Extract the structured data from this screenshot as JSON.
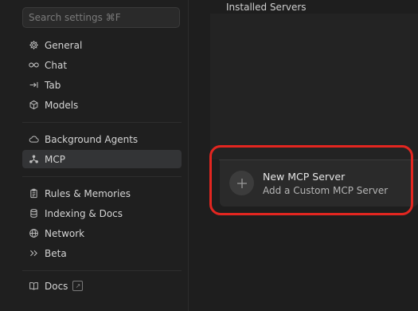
{
  "search": {
    "placeholder": "Search settings ⌘F"
  },
  "sidebar": {
    "items": [
      {
        "label": "General",
        "icon": "gear-icon"
      },
      {
        "label": "Chat",
        "icon": "infinity-icon"
      },
      {
        "label": "Tab",
        "icon": "arrow-to-line-icon"
      },
      {
        "label": "Models",
        "icon": "cube-icon"
      },
      {
        "label": "Background Agents",
        "icon": "cloud-icon"
      },
      {
        "label": "MCP",
        "icon": "nodes-icon",
        "active": true
      },
      {
        "label": "Rules & Memories",
        "icon": "clipboard-icon"
      },
      {
        "label": "Indexing & Docs",
        "icon": "database-icon"
      },
      {
        "label": "Network",
        "icon": "globe-icon"
      },
      {
        "label": "Beta",
        "icon": "double-chevron-right-icon"
      },
      {
        "label": "Docs",
        "icon": "book-icon",
        "external": true
      }
    ]
  },
  "main": {
    "section_title": "Installed Servers",
    "new_server": {
      "title": "New MCP Server",
      "subtitle": "Add a Custom MCP Server"
    }
  },
  "colors": {
    "background": "#1e1e1e",
    "active_item": "#333436",
    "highlight": "#e32620"
  }
}
